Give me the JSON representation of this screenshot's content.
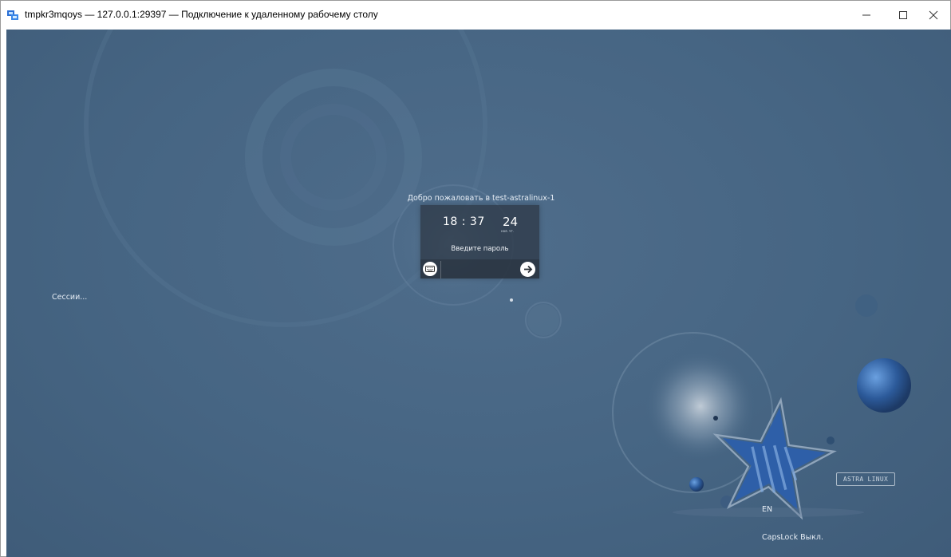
{
  "window": {
    "title": "tmpkr3mqoys — 127.0.0.1:29397 — Подключение к удаленному рабочему столу",
    "minimize_glyph": "—",
    "maximize_glyph": "☐",
    "close_glyph": "✕"
  },
  "login": {
    "welcome": "Добро пожаловать в test-astralinux-1",
    "clock_time": "18 : 37",
    "clock_day": "24",
    "clock_sub": "ноя. чт.",
    "password_label": "Введите пароль",
    "password_value": ""
  },
  "sessions_label": "Сессии...",
  "keyboard_layout": "EN",
  "capslock_status": "CapsLock Выкл.",
  "brand": "ASTRA LINUX",
  "colors": {
    "background": "#466583",
    "card": "#303c4a",
    "text": "#e6edf5"
  },
  "icons": [
    "app-rdp-icon",
    "keyboard-icon",
    "arrow-right-icon"
  ]
}
